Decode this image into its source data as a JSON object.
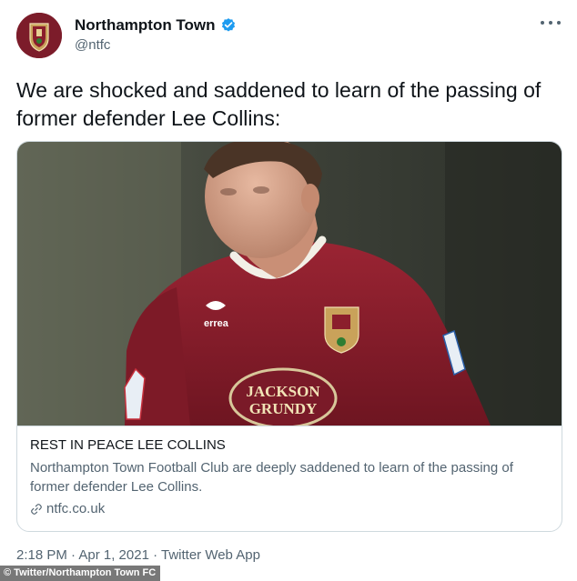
{
  "header": {
    "display_name": "Northampton Town",
    "handle": "@ntfc",
    "verified": true,
    "avatar_icon": "club-crest-icon",
    "avatar_color": "#7c1c2a"
  },
  "tweet": {
    "text": "We are shocked and saddened to learn of the passing of former defender Lee Collins:"
  },
  "card": {
    "title": "REST IN PEACE LEE COLLINS",
    "description": "Northampton Town Football Club are deeply saddened to learn of the passing of former defender Lee Collins.",
    "link": "ntfc.co.uk",
    "image": {
      "shirt_sponsor_line1": "JACKSON",
      "shirt_sponsor_line2": "GRUNDY",
      "kit_brand": "errea",
      "shirt_color": "#8b1e2c"
    }
  },
  "meta": {
    "timestamp": "2:18 PM · Apr 1, 2021 · Twitter Web App"
  },
  "credit": "© Twitter/Northampton Town FC",
  "colors": {
    "verified_blue": "#1d9bf0",
    "text_primary": "#0f1419",
    "text_secondary": "#536471",
    "border": "#cfd9de"
  }
}
